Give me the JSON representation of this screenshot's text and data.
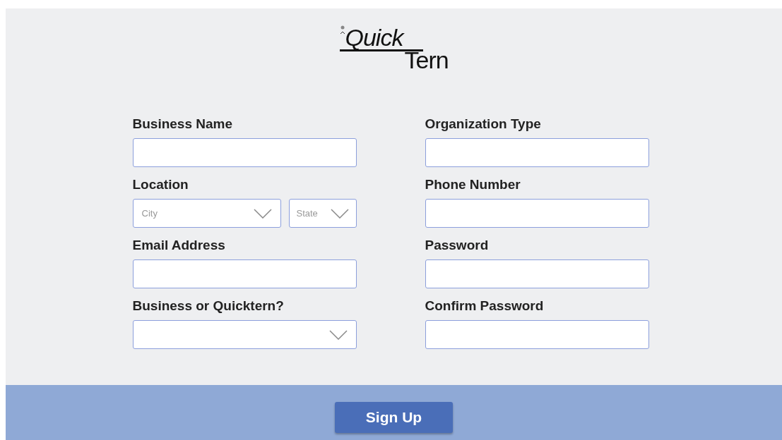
{
  "logo": {
    "line_1": "Quick",
    "line_2": "Tern"
  },
  "fields": [
    {
      "label": "Business Name",
      "kind": "text"
    },
    {
      "label": "Organization Type",
      "kind": "text"
    },
    {
      "label": "Location",
      "kind": "location",
      "selects": [
        {
          "placeholder": "City"
        },
        {
          "placeholder": "State"
        }
      ]
    },
    {
      "label": "Phone Number",
      "kind": "text"
    },
    {
      "label": "Email Address",
      "kind": "text"
    },
    {
      "label": "Password",
      "kind": "text"
    },
    {
      "label": "Business or Quicktern?",
      "kind": "select"
    },
    {
      "label": "Confirm Password",
      "kind": "text"
    }
  ],
  "submit": {
    "label": "Sign Up"
  }
}
